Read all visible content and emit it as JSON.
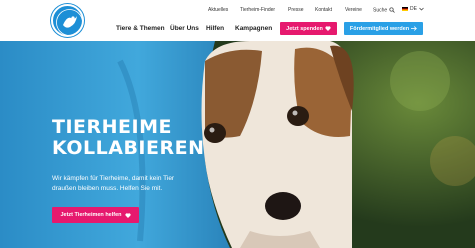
{
  "header": {
    "logo_icon": "tierschutzbund-logo",
    "top_links": [
      "Aktuelles",
      "Tierheim-Finder",
      "Presse",
      "Kontakt",
      "Vereine",
      "Suche"
    ],
    "language": "DE",
    "main_links": [
      "Tiere & Themen",
      "Über Uns",
      "Hilfen",
      "Kampagnen"
    ],
    "donate_label": "Jetzt spenden",
    "member_label": "Fördermitglied werden"
  },
  "hero": {
    "title_line1": "TIERHEIME",
    "title_line2": "KOLLABIEREN",
    "text": "Wir kämpfen für Tierheime, damit kein Tier draußen bleiben muss. Helfen Sie mit.",
    "cta_label": "Jetzt Tierheimen helfen"
  },
  "colors": {
    "pink": "#e6196e",
    "blue": "#2aa0e6",
    "logo_blue": "#1d8fd6"
  }
}
